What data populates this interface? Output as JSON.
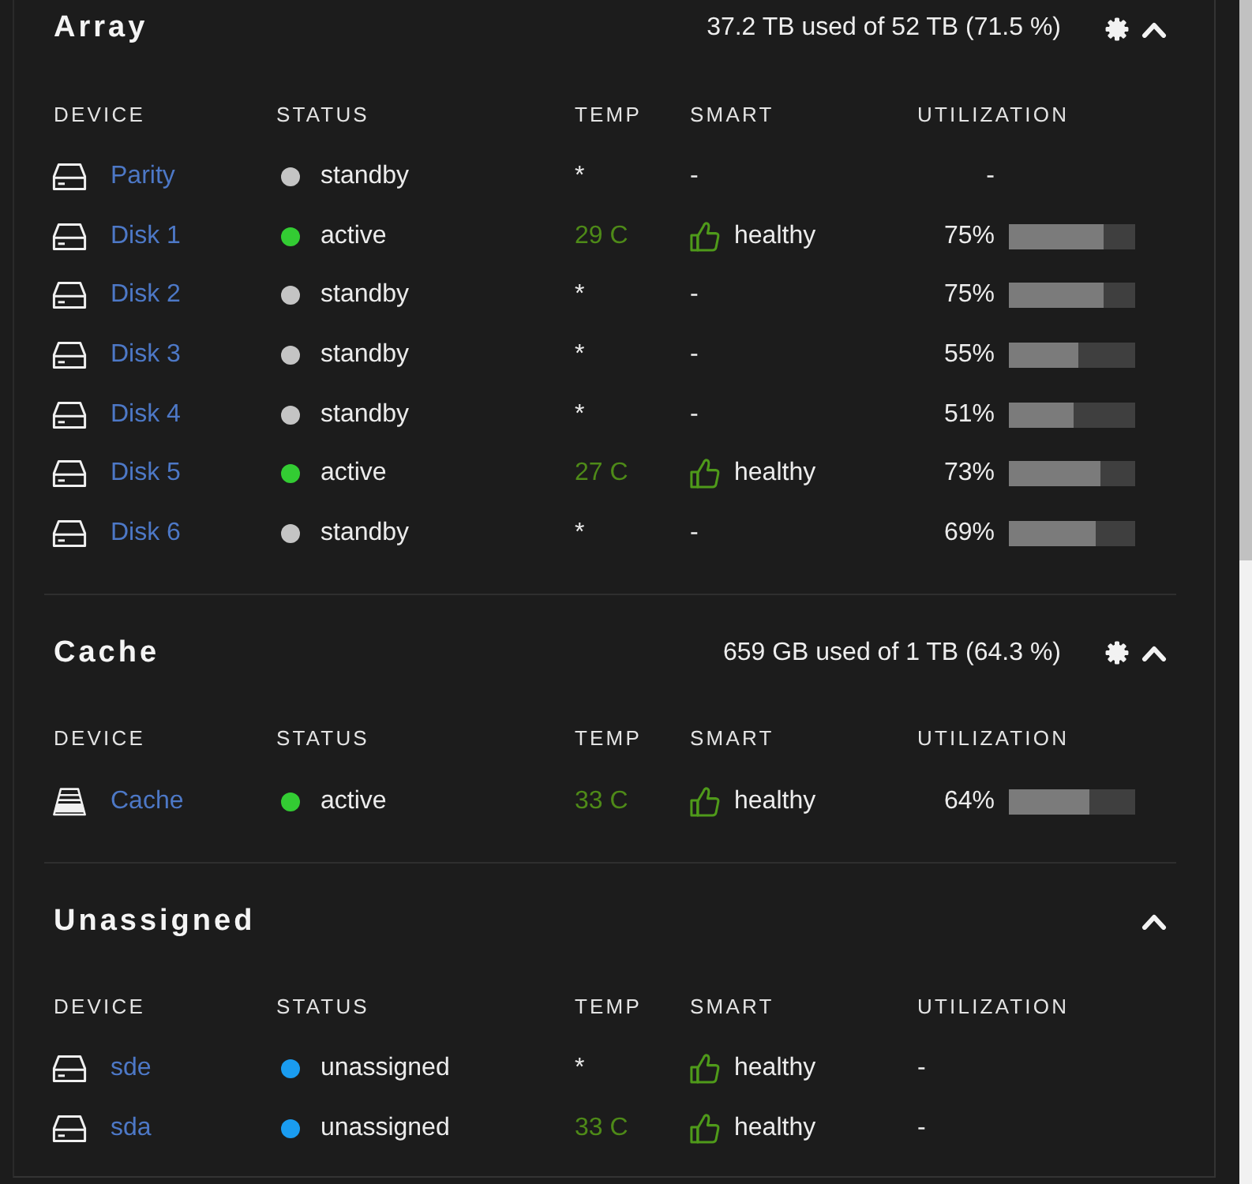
{
  "sections": [
    {
      "title": "Array",
      "kind": "pool",
      "usage": "37.2 TB used of 52 TB (71.5 %)",
      "settings": true,
      "expanded": true,
      "columns": [
        "DEVICE",
        "STATUS",
        "TEMP",
        "SMART",
        "UTILIZATION"
      ],
      "rows": [
        {
          "kind": "hdd",
          "device": "Parity",
          "status": {
            "text": "standby",
            "color": "#c4c4c4"
          },
          "temp": {
            "text": "*",
            "color": "#e8e8e8"
          },
          "smart": "-",
          "smart_healthy": false,
          "utilization": "-"
        },
        {
          "kind": "hdd",
          "device": "Disk 1",
          "status": {
            "text": "active",
            "color": "#33cc33"
          },
          "temp": {
            "text": "29 C",
            "color": "#4e8a18"
          },
          "smart": "healthy",
          "smart_healthy": true,
          "utilization": "75%",
          "level": 0.75
        },
        {
          "kind": "hdd",
          "device": "Disk 2",
          "status": {
            "text": "standby",
            "color": "#c4c4c4"
          },
          "temp": {
            "text": "*",
            "color": "#e8e8e8"
          },
          "smart": "-",
          "smart_healthy": false,
          "utilization": "75%",
          "level": 0.75
        },
        {
          "kind": "hdd",
          "device": "Disk 3",
          "status": {
            "text": "standby",
            "color": "#c4c4c4"
          },
          "temp": {
            "text": "*",
            "color": "#e8e8e8"
          },
          "smart": "-",
          "smart_healthy": false,
          "utilization": "55%",
          "level": 0.55
        },
        {
          "kind": "hdd",
          "device": "Disk 4",
          "status": {
            "text": "standby",
            "color": "#c4c4c4"
          },
          "temp": {
            "text": "*",
            "color": "#e8e8e8"
          },
          "smart": "-",
          "smart_healthy": false,
          "utilization": "51%",
          "level": 0.51
        },
        {
          "kind": "hdd",
          "device": "Disk 5",
          "status": {
            "text": "active",
            "color": "#33cc33"
          },
          "temp": {
            "text": "27 C",
            "color": "#4e8a18"
          },
          "smart": "healthy",
          "smart_healthy": true,
          "utilization": "73%",
          "level": 0.73
        },
        {
          "kind": "hdd",
          "device": "Disk 6",
          "status": {
            "text": "standby",
            "color": "#c4c4c4"
          },
          "temp": {
            "text": "*",
            "color": "#e8e8e8"
          },
          "smart": "-",
          "smart_healthy": false,
          "utilization": "69%",
          "level": 0.69
        }
      ]
    },
    {
      "title": "Cache",
      "kind": "pool",
      "usage": "659 GB used of 1 TB (64.3 %)",
      "settings": true,
      "expanded": true,
      "columns": [
        "DEVICE",
        "STATUS",
        "TEMP",
        "SMART",
        "UTILIZATION"
      ],
      "rows": [
        {
          "kind": "ssd",
          "device": "Cache",
          "status": {
            "text": "active",
            "color": "#33cc33"
          },
          "temp": {
            "text": "33 C",
            "color": "#4e8a18"
          },
          "smart": "healthy",
          "smart_healthy": true,
          "utilization": "64%",
          "level": 0.64
        }
      ]
    },
    {
      "title": "Unassigned",
      "kind": "unassigned",
      "settings": false,
      "expanded": true,
      "columns": [
        "DEVICE",
        "STATUS",
        "TEMP",
        "SMART",
        "UTILIZATION"
      ],
      "rows": [
        {
          "kind": "hdd",
          "device": "sde",
          "status": {
            "text": "unassigned",
            "color": "#1a9cf0"
          },
          "temp": {
            "text": "*",
            "color": "#e8e8e8"
          },
          "smart": "healthy",
          "smart_healthy": true,
          "utilization": "-"
        },
        {
          "kind": "hdd",
          "device": "sda",
          "status": {
            "text": "unassigned",
            "color": "#1a9cf0"
          },
          "temp": {
            "text": "33 C",
            "color": "#4e8a18"
          },
          "smart": "healthy",
          "smart_healthy": true,
          "utilization": "-"
        }
      ]
    }
  ]
}
